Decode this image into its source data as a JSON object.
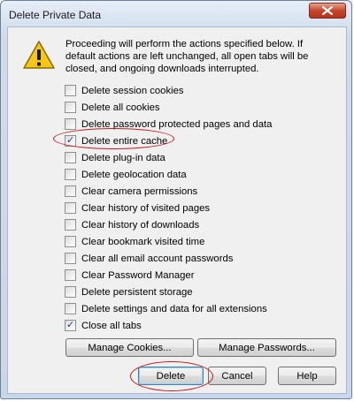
{
  "window": {
    "title": "Delete Private Data"
  },
  "message": "Proceeding will perform the actions specified below. If default actions are left unchanged, all open tabs will be closed, and ongoing downloads interrupted.",
  "options": [
    {
      "label": "Delete session cookies",
      "checked": false
    },
    {
      "label": "Delete all cookies",
      "checked": false
    },
    {
      "label": "Delete password protected pages and data",
      "checked": false
    },
    {
      "label": "Delete entire cache",
      "checked": true
    },
    {
      "label": "Delete plug-in data",
      "checked": false
    },
    {
      "label": "Delete geolocation data",
      "checked": false
    },
    {
      "label": "Clear camera permissions",
      "checked": false
    },
    {
      "label": "Clear history of visited pages",
      "checked": false
    },
    {
      "label": "Clear history of downloads",
      "checked": false
    },
    {
      "label": "Clear bookmark visited time",
      "checked": false
    },
    {
      "label": "Clear all email account passwords",
      "checked": false
    },
    {
      "label": "Clear Password Manager",
      "checked": false
    },
    {
      "label": "Delete persistent storage",
      "checked": false
    },
    {
      "label": "Delete settings and data for all extensions",
      "checked": false
    },
    {
      "label": "Close all tabs",
      "checked": true
    }
  ],
  "buttons": {
    "manage_cookies": "Manage Cookies...",
    "manage_passwords": "Manage Passwords...",
    "delete": "Delete",
    "cancel": "Cancel",
    "help": "Help"
  },
  "colors": {
    "annotation": "#c0191e",
    "warning_fill": "#f5c518",
    "close_button": "#c4452a"
  },
  "icons": {
    "warning": "warning-icon",
    "close": "close-icon",
    "check": "checkmark-icon"
  }
}
